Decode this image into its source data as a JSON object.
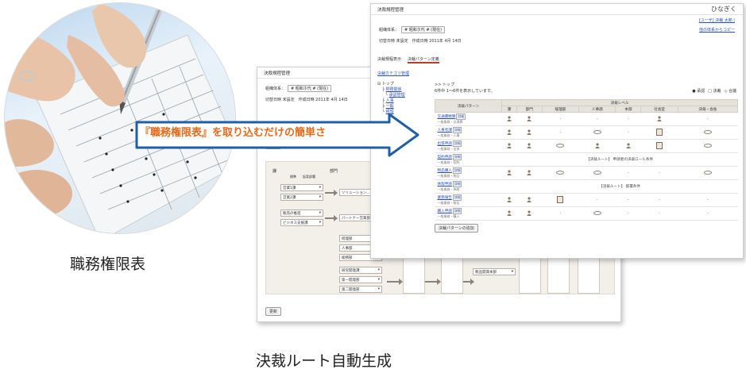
{
  "captions": {
    "left": "職務権限表",
    "bottom": "決裁ルート自動生成",
    "arrow": "『職務権限表』を取り込むだけの簡単さ"
  },
  "colors": {
    "arrow_fill": "#ffffff",
    "arrow_border": "#1f5fa8",
    "arrow_text": "#e56a1b"
  },
  "back_screen": {
    "app_title": "決裁規程管理",
    "org_label": "組織体系：",
    "org_value": "# 昭和ホ代 # (現在)",
    "date_line": "切替日時 未設定　作成日時 2011年 4月 14日",
    "update_button": "更新",
    "columns": [
      "課",
      "部門"
    ],
    "col_sub": [
      "標準",
      "起案部署"
    ],
    "left_boxes": [
      "営業1課",
      "営業2課",
      "販売の推進",
      "ビジネス支援課"
    ],
    "mid_boxes": [
      "ソリューション...",
      "パートナー営業部"
    ],
    "lower_boxes": [
      "経理部",
      "人事部",
      "総務部",
      "研究開発課",
      "第一開発部",
      "第二開発部",
      "品質管理部"
    ],
    "right_box": "製品開発本部",
    "bottom_button": "更新"
  },
  "front_screen": {
    "app_title": "決裁規程管理",
    "logo": "ひなぎく",
    "user_links": "[ユーザ] 決裁 太郎 |",
    "org_label": "組織体系：",
    "org_value": "# 昭和ホ代 # (現在)",
    "copy_link": "他の体系からコピー",
    "date_line": "切替日時 未設定　作成日時 2011年 4月 14日",
    "tabs": [
      "決裁規程表示",
      "決裁パターン定義"
    ],
    "category_link": "決裁カテゴリ管理",
    "tree": [
      "トップ",
      "財務関係",
      "承認管理",
      "人事",
      "一般",
      "経理"
    ],
    "breadcrumb": ">> トップ",
    "count_line": "6件中 1～6件を表示しています。",
    "legend": [
      "● 承認",
      "□ 決裁",
      "◇ 合議"
    ],
    "headers": [
      "決裁パターン",
      "課",
      "部門",
      "経理部",
      "人事部",
      "本部",
      "社長室",
      "決裁・会長"
    ],
    "header_group": "決裁レベル",
    "rows": [
      {
        "name": "交通費精算",
        "sub": "一般業務・交通費",
        "note": ""
      },
      {
        "name": "人事考課",
        "sub": "一般業務・人事",
        "note": ""
      },
      {
        "name": "出張申請",
        "sub": "一般業務・出張",
        "note": ""
      },
      {
        "name": "契約申請",
        "sub": "一般業務・契約",
        "note": "【決裁ルート】 申請者の決裁ロール条件"
      },
      {
        "name": "物品購入",
        "sub": "一般業務・物品",
        "note": ""
      },
      {
        "name": "休暇申請",
        "sub": "一般業務・休暇",
        "note": "【決裁ルート】 部署条件"
      },
      {
        "name": "業務報告",
        "sub": "一般業務・報告",
        "note": ""
      },
      {
        "name": "購入申請",
        "sub": "一般業務・購入",
        "note": ""
      }
    ],
    "row_note_first": "【決裁ルート】 部署条件",
    "mini_label": "詳細",
    "add_button": "決裁パターンの追加"
  }
}
